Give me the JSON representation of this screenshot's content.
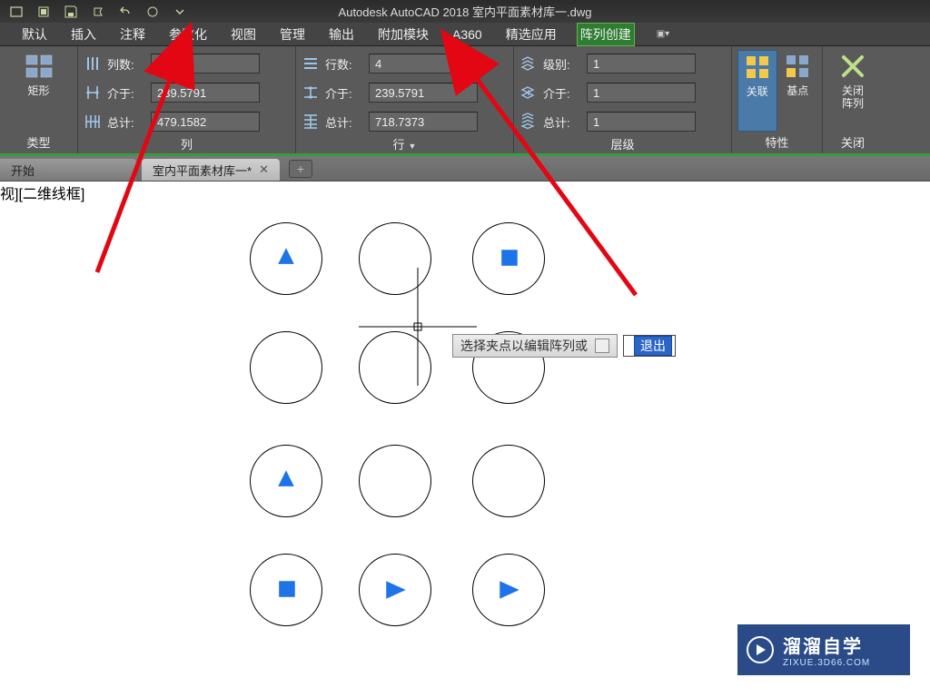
{
  "app": {
    "title": "Autodesk AutoCAD 2018    室内平面素材库一.dwg"
  },
  "menus": [
    "默认",
    "插入",
    "注释",
    "参数化",
    "视图",
    "管理",
    "输出",
    "附加模块",
    "A360",
    "精选应用",
    "阵列创建"
  ],
  "active_menu_index": 10,
  "ribbon": {
    "type_panel": {
      "label": "类型",
      "btn": "矩形"
    },
    "col_panel": {
      "label": "列",
      "count_lbl": "列数:",
      "count_val": "3",
      "between_lbl": "介于:",
      "between_val": "239.5791",
      "total_lbl": "总计:",
      "total_val": "479.1582"
    },
    "row_panel": {
      "label": "行",
      "count_lbl": "行数:",
      "count_val": "4",
      "between_lbl": "介于:",
      "between_val": "239.5791",
      "total_lbl": "总计:",
      "total_val": "718.7373"
    },
    "level_panel": {
      "label": "层级",
      "count_lbl": "级别:",
      "count_val": "1",
      "between_lbl": "介于:",
      "between_val": "1",
      "total_lbl": "总计:",
      "total_val": "1"
    },
    "props_panel": {
      "label": "特性",
      "assoc": "关联",
      "base": "基点"
    },
    "close_panel": {
      "label": "关闭",
      "close1": "关闭",
      "close2": "阵列"
    }
  },
  "tabs": {
    "start": "开始",
    "active": "室内平面素材库一*",
    "plus": "+"
  },
  "viewport_label": "视][二维线框]",
  "tooltip": {
    "text": "选择夹点以编辑阵列或",
    "exit": "退出"
  },
  "watermark": {
    "name": "溜溜自学",
    "url": "ZIXUE.3D66.COM"
  }
}
